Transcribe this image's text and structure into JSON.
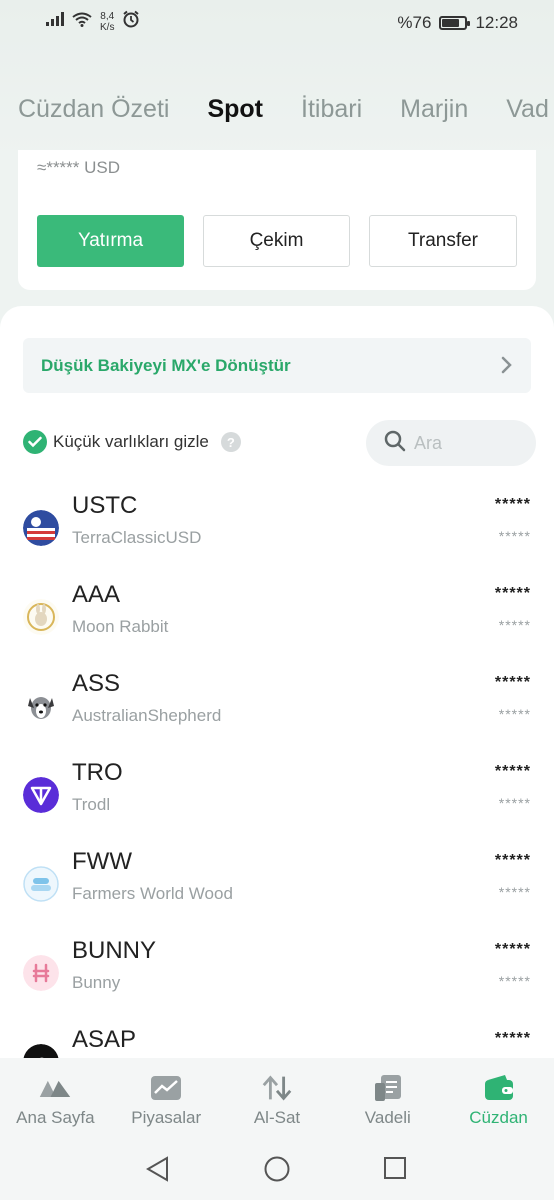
{
  "status_bar": {
    "net_speed_value": "8,4",
    "net_speed_unit": "K/s",
    "battery_text": "%76",
    "battery_level": 0.76,
    "time": "12:28"
  },
  "tabs": [
    {
      "label": "Cüzdan Özeti"
    },
    {
      "label": "Spot"
    },
    {
      "label": "İtibari"
    },
    {
      "label": "Marjin"
    },
    {
      "label": "Vad"
    }
  ],
  "balance": {
    "text": "≈***** USD",
    "deposit_label": "Yatırma",
    "withdraw_label": "Çekim",
    "transfer_label": "Transfer"
  },
  "convert_banner": {
    "label": "Düşük Bakiyeyi MX'e Dönüştür"
  },
  "filter": {
    "hide_small_label": "Küçük varlıkları gizle",
    "help": "?",
    "search_placeholder": "Ara"
  },
  "assets": [
    {
      "symbol": "USTC",
      "name": "TerraClassicUSD",
      "amount": "*****",
      "value": "*****"
    },
    {
      "symbol": "AAA",
      "name": "Moon Rabbit",
      "amount": "*****",
      "value": "*****"
    },
    {
      "symbol": "ASS",
      "name": "AustralianShepherd",
      "amount": "*****",
      "value": "*****"
    },
    {
      "symbol": "TRO",
      "name": "Trodl",
      "amount": "*****",
      "value": "*****"
    },
    {
      "symbol": "FWW",
      "name": "Farmers World Wood",
      "amount": "*****",
      "value": "*****"
    },
    {
      "symbol": "BUNNY",
      "name": "Bunny",
      "amount": "*****",
      "value": "*****"
    },
    {
      "symbol": "ASAP",
      "name": "",
      "amount": "*****",
      "value": ""
    }
  ],
  "bottom_nav": [
    {
      "label": "Ana Sayfa",
      "icon": "home-icon"
    },
    {
      "label": "Piyasalar",
      "icon": "markets-icon"
    },
    {
      "label": "Al-Sat",
      "icon": "trade-icon"
    },
    {
      "label": "Vadeli",
      "icon": "futures-icon"
    },
    {
      "label": "Cüzdan",
      "icon": "wallet-icon"
    }
  ],
  "colors": {
    "accent": "#3aba7a",
    "active_nav": "#2fb374"
  }
}
